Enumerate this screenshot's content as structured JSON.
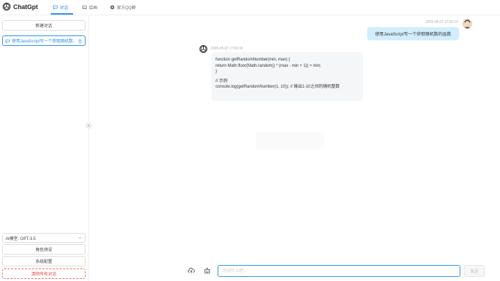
{
  "header": {
    "brand": "ChatGpt",
    "tabs": [
      {
        "label": "对话",
        "icon": "chat-icon",
        "active": true
      },
      {
        "label": "绘画",
        "icon": "image-icon",
        "active": false
      },
      {
        "label": "官方QQ群",
        "icon": "github-icon",
        "active": false
      }
    ],
    "accent": "#2d8cf0"
  },
  "sidebar": {
    "new_chat_label": "新建对话",
    "chats": [
      {
        "label": "使用JavaScript写一个获取随机数..."
      }
    ],
    "model_select": {
      "value": "AI模型: GPT-3.5"
    },
    "role_preset_label": "角色预设",
    "system_config_label": "系统配置",
    "clear_all_label": "清除所有对话"
  },
  "messages": [
    {
      "role": "user",
      "time": "2025-05-07 17:50:13",
      "text": "使用JavaScript写一个获取随机数的函数"
    },
    {
      "role": "assistant",
      "time": "2025-05-07 17:50:16",
      "lines": [
        "function getRandomNumber(min, max) {",
        "return Math.floor(Math.random() * (max - min + 1)) + min;",
        "}",
        "",
        "// 示例",
        "console.log(getRandomNumber(1, 10)); // 输出1-10之间的随机整数"
      ]
    }
  ],
  "composer": {
    "placeholder": "问点什么吧...",
    "value": "",
    "send_label": "发送"
  }
}
